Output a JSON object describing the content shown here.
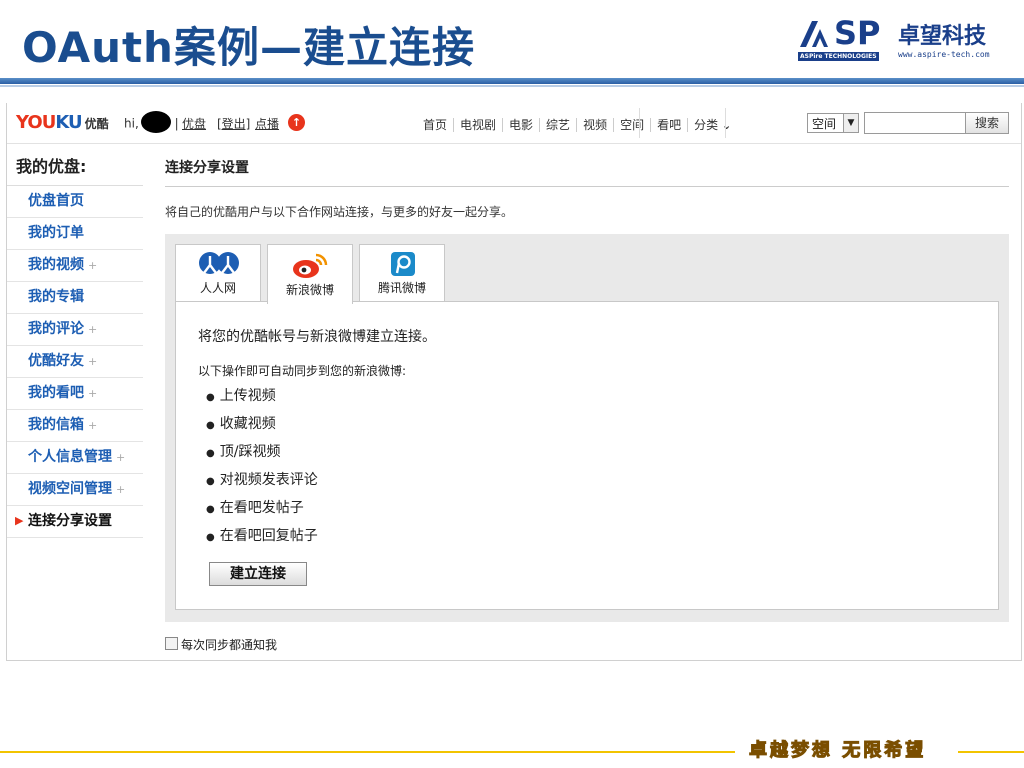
{
  "slide": {
    "title": "OAuth案例—建立连接",
    "logo_sp": "SP",
    "logo_cn": "卓望科技",
    "logo_sub": "ASPire TECHNOLOGIES",
    "logo_url": "www.aspire-tech.com",
    "slogan": "卓越梦想  无限希望"
  },
  "header": {
    "logo_a": "YOU",
    "logo_b": "KU",
    "logo_c": "优酷",
    "greeting": "hi,",
    "sep": "|",
    "link_youpan": "优盘",
    "link_logout": "[登出]",
    "link_dianbo": "点播",
    "nav": [
      "首页",
      "电视剧",
      "电影",
      "综艺",
      "视频",
      "空间",
      "看吧",
      "分类"
    ],
    "select_value": "空间",
    "search_button": "搜索"
  },
  "sidebar": {
    "title": "我的优盘:",
    "items": [
      {
        "label": "优盘首页",
        "plus": ""
      },
      {
        "label": "我的订单",
        "plus": ""
      },
      {
        "label": "我的视频",
        "plus": "+"
      },
      {
        "label": "我的专辑",
        "plus": ""
      },
      {
        "label": "我的评论",
        "plus": "+"
      },
      {
        "label": "优酷好友",
        "plus": "+"
      },
      {
        "label": "我的看吧",
        "plus": "+"
      },
      {
        "label": "我的信箱",
        "plus": "+"
      },
      {
        "label": "个人信息管理",
        "plus": "+"
      },
      {
        "label": "视频空间管理",
        "plus": "+"
      },
      {
        "label": "连接分享设置",
        "plus": ""
      }
    ]
  },
  "main": {
    "title": "连接分享设置",
    "description": "将自己的优酷用户与以下合作网站连接，与更多的好友一起分享。",
    "tabs": [
      {
        "label": "人人网"
      },
      {
        "label": "新浪微博"
      },
      {
        "label": "腾讯微博"
      }
    ],
    "intro": "将您的优酷帐号与新浪微博建立连接。",
    "sync_heading": "以下操作即可自动同步到您的新浪微博:",
    "sync_items": [
      "上传视频",
      "收藏视频",
      "顶/踩视频",
      "对视频发表评论",
      "在看吧发帖子",
      "在看吧回复帖子"
    ],
    "connect_button": "建立连接",
    "notify_label": "每次同步都通知我"
  },
  "colors": {
    "title_blue": "#1a4d8f",
    "youku_red": "#e8341c",
    "link_blue": "#1d5eb3",
    "gold": "#f2c400"
  }
}
